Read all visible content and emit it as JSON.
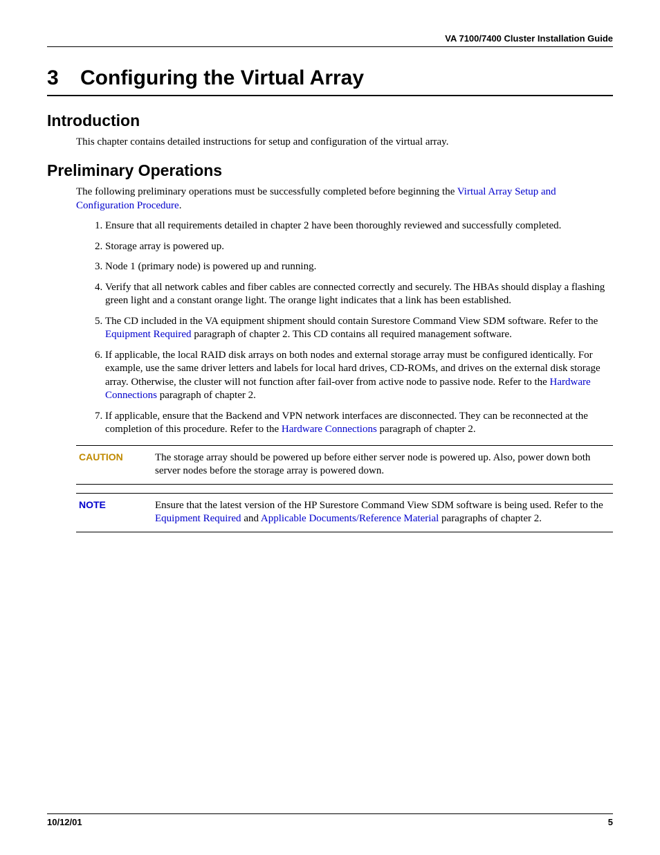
{
  "header": {
    "guide": "VA 7100/7400 Cluster Installation Guide"
  },
  "chapter": {
    "number": "3",
    "title": "Configuring the Virtual Array"
  },
  "intro": {
    "heading": "Introduction",
    "p1": "This chapter contains detailed instructions for setup and configuration of the virtual array."
  },
  "prelim": {
    "heading": "Preliminary Operations",
    "lead_pre": "The following preliminary operations must be successfully completed before beginning the ",
    "lead_link": "Virtual Array Setup and Configuration Procedure",
    "lead_post": ".",
    "items": {
      "i1": "Ensure that all requirements detailed in chapter 2 have been thoroughly reviewed and successfully completed.",
      "i2": "Storage array is powered up.",
      "i3": "Node 1 (primary node) is powered up and running.",
      "i4": "Verify that all network cables and fiber cables are connected correctly and securely.  The HBAs should display a flashing green light and a constant orange light.  The orange light indicates that a link has been established.",
      "i5_pre": "The CD included in the VA equipment shipment should contain Surestore Command View SDM software.  Refer to the ",
      "i5_link": "Equipment Required",
      "i5_post": " paragraph of chapter 2.  This CD contains all required management software.",
      "i6_pre": "If applicable, the local RAID disk arrays on both nodes and external storage array must be configured identically.  For example, use the same driver letters and labels for local hard drives, CD-ROMs, and drives on the external disk storage array.  Otherwise, the cluster will not function after fail-over from active node to passive node.  Refer to the ",
      "i6_link": "Hardware Connections",
      "i6_post": " paragraph of chapter 2.",
      "i7_pre": "If applicable, ensure that the Backend and VPN network interfaces are disconnected.  They can be reconnected at the completion of this procedure.  Refer to the ",
      "i7_link": "Hardware Connections",
      "i7_post": " paragraph of chapter 2."
    }
  },
  "caution": {
    "label": "CAUTION",
    "text": "The storage array should be powered up before either server node is powered up.  Also, power down both server nodes before the storage array is powered down."
  },
  "note": {
    "label": "NOTE",
    "pre": "Ensure that the latest version of the HP Surestore Command View SDM software is being used.  Refer to the ",
    "link1": "Equipment Required",
    "mid": " and ",
    "link2": "Applicable Documents/Reference Material",
    "post": " paragraphs of chapter 2."
  },
  "footer": {
    "date": "10/12/01",
    "page": "5"
  }
}
